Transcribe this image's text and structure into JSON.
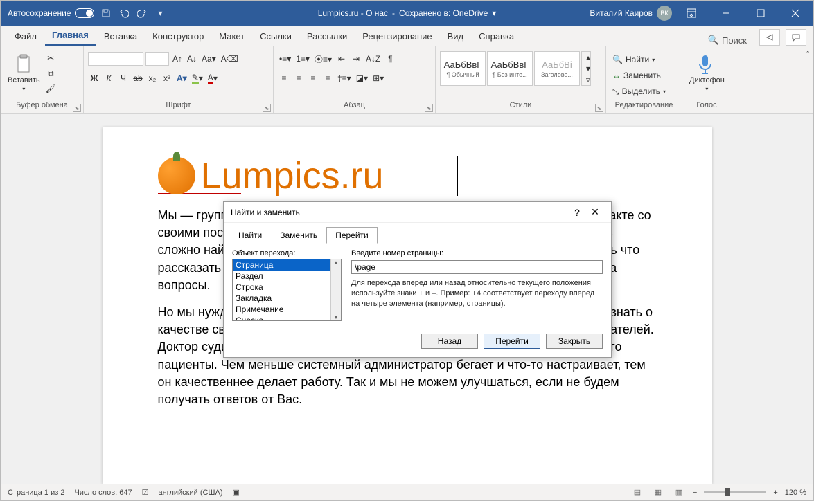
{
  "titlebar": {
    "autosave": "Автосохранение",
    "doc_title": "Lumpics.ru - О нас",
    "saved_to": "Сохранено в: OneDrive",
    "user_name": "Виталий Каиров",
    "user_initials": "ВК"
  },
  "tabs": {
    "file": "Файл",
    "home": "Главная",
    "insert": "Вставка",
    "draw": "Конструктор",
    "layout": "Макет",
    "references": "Ссылки",
    "mailings": "Рассылки",
    "review": "Рецензирование",
    "view": "Вид",
    "help": "Справка",
    "search": "Поиск"
  },
  "ribbon": {
    "paste": "Вставить",
    "clipboard": "Буфер обмена",
    "font": "Шрифт",
    "paragraph": "Абзац",
    "styles": "Стили",
    "editing": "Редактирование",
    "voice": "Голос",
    "dictate": "Диктофон",
    "style1": "¶ Обычный",
    "style2": "¶ Без инте...",
    "style3": "Заголово...",
    "style_prev": "АаБбВвГ",
    "style_prev3": "АаБбВі",
    "find": "Найти",
    "replace": "Заменить",
    "select": "Выделить",
    "bold": "Ж",
    "italic": "К",
    "underline": "Ч",
    "strike": "ab"
  },
  "document": {
    "logo_text": "Lumpics.ru",
    "para1_frag": "Мы — группа энтузиастов, которая находится в постоянном ежедневном контакте со своими посетителями. Мы считаем это важным, потому что в интернете очень сложно найти качественную информацию о работе с компьютером. А нам есть что рассказать Вам. И хочется помогать Вам, как решать задачи, так и отвечать на вопросы.",
    "para2_frag": "Но мы нуждаемся и в обратной связи. Как и любому другому человеку важно знать о качестве своей работы. Учитель может судить о своей работе по отзывам читателей. Доктор судит о качестве своей работы по тому, как быстро выздоравливают его пациенты. Чем меньше системный администратор бегает и что-то настраивает, тем он качественнее делает работу. Так и мы не можем улучшаться, если не будем получать ответов от Вас."
  },
  "dialog": {
    "title": "Найти и заменить",
    "tab_find": "Найти",
    "tab_replace": "Заменить",
    "tab_goto": "Перейти",
    "obj_label": "Объект перехода:",
    "items": {
      "page": "Страница",
      "section": "Раздел",
      "line": "Строка",
      "bookmark": "Закладка",
      "comment": "Примечание",
      "footnote": "Сноска"
    },
    "input_label": "Введите номер страницы:",
    "input_value": "\\page",
    "help_text": "Для перехода вперед или назад относительно текущего положения используйте знаки + и –. Пример: +4 соответствует переходу вперед на четыре элемента (например, страницы).",
    "btn_back": "Назад",
    "btn_goto": "Перейти",
    "btn_close": "Закрыть"
  },
  "statusbar": {
    "page": "Страница 1 из 2",
    "words": "Число слов: 647",
    "lang": "английский (США)",
    "zoom": "120 %"
  }
}
